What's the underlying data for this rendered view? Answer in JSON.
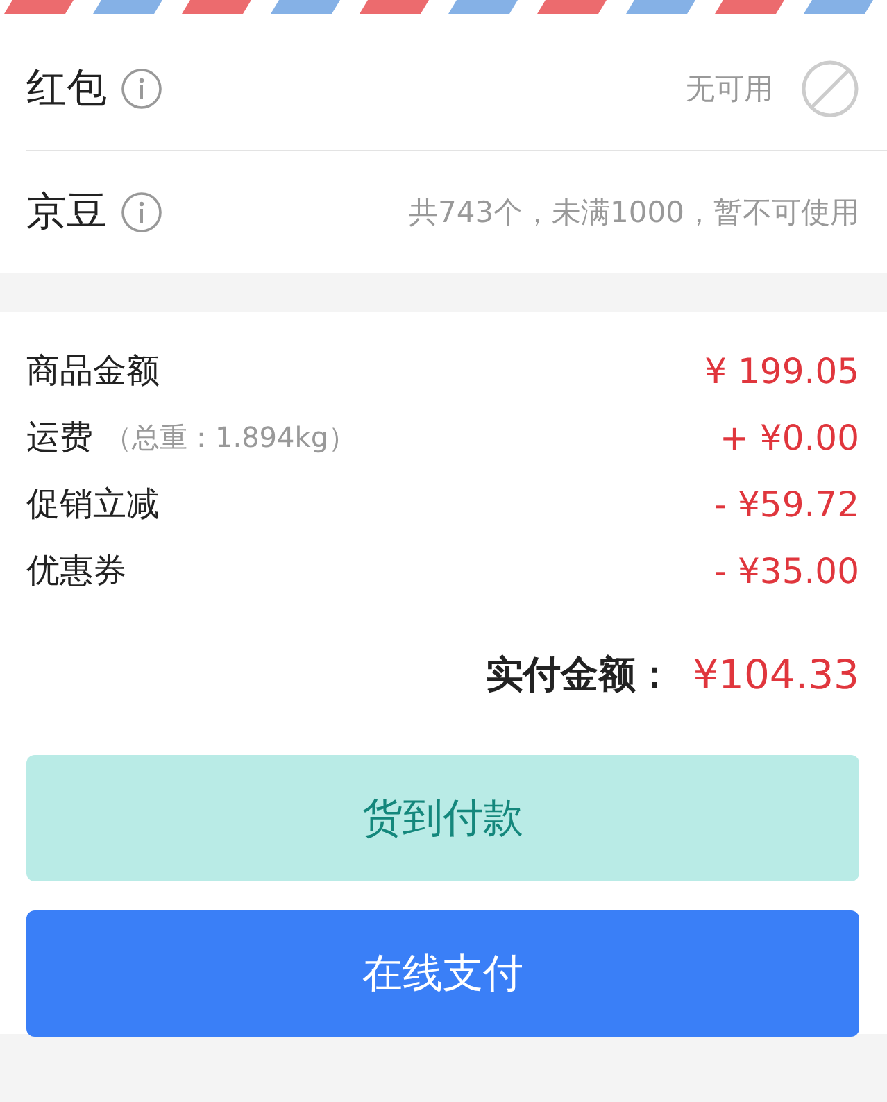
{
  "benefits": [
    {
      "label": "红包",
      "status": "无可用",
      "kind": "unavailable"
    },
    {
      "label": "京豆",
      "status": "共743个，未满1000，暂不可使用",
      "kind": "plain"
    }
  ],
  "summary": [
    {
      "label": "商品金额",
      "amount": "¥ 199.05"
    },
    {
      "label": "运费",
      "note": "（总重：1.894kg）",
      "amount": "+ ¥0.00"
    },
    {
      "label": "促销立减",
      "amount": "- ¥59.72"
    },
    {
      "label": "优惠券",
      "amount": "- ¥35.00"
    }
  ],
  "total": {
    "label": "实付金额：",
    "amount": "¥104.33"
  },
  "buttons": [
    {
      "label": "货到付款",
      "kind": "secondary"
    },
    {
      "label": "在线支付",
      "kind": "primary"
    }
  ]
}
